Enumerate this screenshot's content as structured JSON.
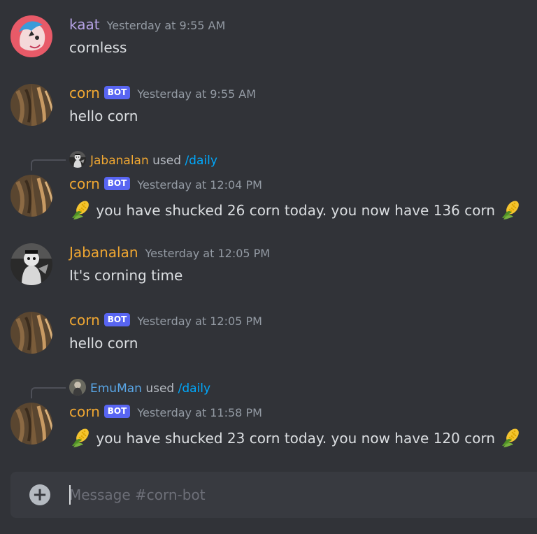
{
  "colors": {
    "background": "#313338",
    "user_orange": "#f0a732",
    "user_blue": "#59a6e6",
    "user_purple": "#b7a3e6",
    "bot_badge": "#5865f2",
    "command": "#00a8fc"
  },
  "messages": [
    {
      "username": "kaat",
      "timestamp": "Yesterday at 9:55 AM",
      "text": "cornless"
    },
    {
      "username": "corn",
      "badge": "BOT",
      "timestamp": "Yesterday at 9:55 AM",
      "text": "hello corn"
    },
    {
      "reply_user": "Jabanalan",
      "reply_used": "used",
      "reply_command": "/daily",
      "username": "corn",
      "badge": "BOT",
      "timestamp": "Yesterday at 12:04 PM",
      "text": "you have shucked 26 corn today. you now have 136 corn"
    },
    {
      "username": "Jabanalan",
      "timestamp": "Yesterday at 12:05 PM",
      "text": "It's corning time"
    },
    {
      "username": "corn",
      "badge": "BOT",
      "timestamp": "Yesterday at 12:05 PM",
      "text": "hello corn"
    },
    {
      "reply_user": "EmuMan",
      "reply_used": "used",
      "reply_command": "/daily",
      "username": "corn",
      "badge": "BOT",
      "timestamp": "Yesterday at 11:58 PM",
      "text": "you have shucked 23 corn today. you now have 120 corn"
    }
  ],
  "composer": {
    "placeholder": "Message #corn-bot"
  },
  "icons": {
    "corn": "corn-emoji-icon",
    "add": "plus-circle-icon"
  }
}
